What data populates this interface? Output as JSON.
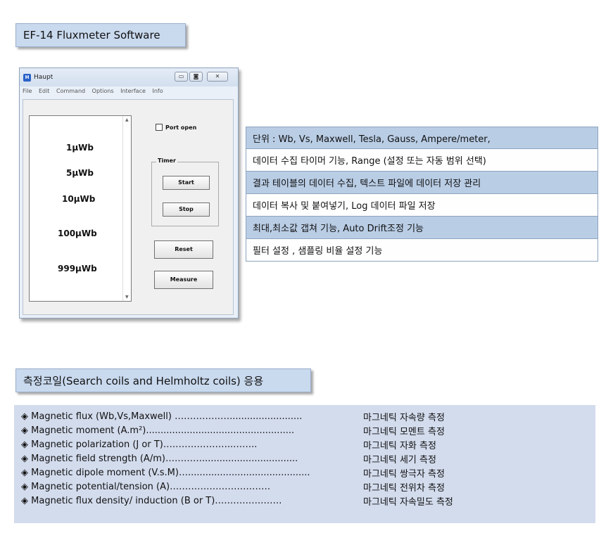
{
  "section1": {
    "title": "EF-14 Fluxmeter Software"
  },
  "window": {
    "title": "Haupt",
    "controls": {
      "minimize": "▭",
      "maximize": "◙",
      "close": "✕"
    },
    "menu": [
      "File",
      "Edit",
      "Command",
      "Options",
      "Interface",
      "Info"
    ],
    "ranges": [
      "1µWb",
      "5µWb",
      "10µWb",
      "100µWb",
      "999µWb"
    ],
    "port_open": "Port open",
    "timer_group": "Timer",
    "start_btn": "Start",
    "stop_btn": "Stop",
    "reset_btn": "Reset",
    "measure_btn": "Measure",
    "logo_glyph": "H"
  },
  "features": [
    "단위 : Wb, Vs, Maxwell,  Tesla, Gauss, Ampere/meter,",
    "데이터 수집 타이머 기능, Range (설정 또는 자동 범위 선택)",
    "결과 테이블의 데이터 수집, 텍스트 파일에 데이터 저장 관리",
    "데이터 복사 및 붙여넣기, Log 데이터 파일 저장",
    "최대,최소값 갭쳐 기능, Auto Drift조정 기능",
    "필터 설정 , 샘플링 비율 설정 기능"
  ],
  "section2": {
    "title": "측정코일(Search coils and Helmholtz coils) 응용"
  },
  "applications": [
    {
      "left": "◈ Magnetic flux (Wb,Vs,Maxwell) ……………….........................",
      "right": "마그네틱 자속량 측정"
    },
    {
      "left": "◈ Magnetic moment (A.m²)...................................................",
      "right": "마그네틱 모멘트 측정"
    },
    {
      "left": "◈ Magnetic polarization (J or T)…………………..……..",
      "right": "마그네틱 자화 측정"
    },
    {
      "left": "◈ Magnetic field strength (A/m)………….................................",
      "right": "마그네틱 세기 측정"
    },
    {
      "left": "◈ Magnetic dipole moment (V.s.M)…..........................................",
      "right": "마그네틱 쌍극자 측정"
    },
    {
      "left": "◈ Magnetic potential/tension (A)……………………………",
      "right": "마그네틱 전위차 측정"
    },
    {
      "left": "◈ Magnetic flux density/ induction (B or T)…………….……",
      "right": "마그네틱 자속밀도 측정"
    }
  ]
}
